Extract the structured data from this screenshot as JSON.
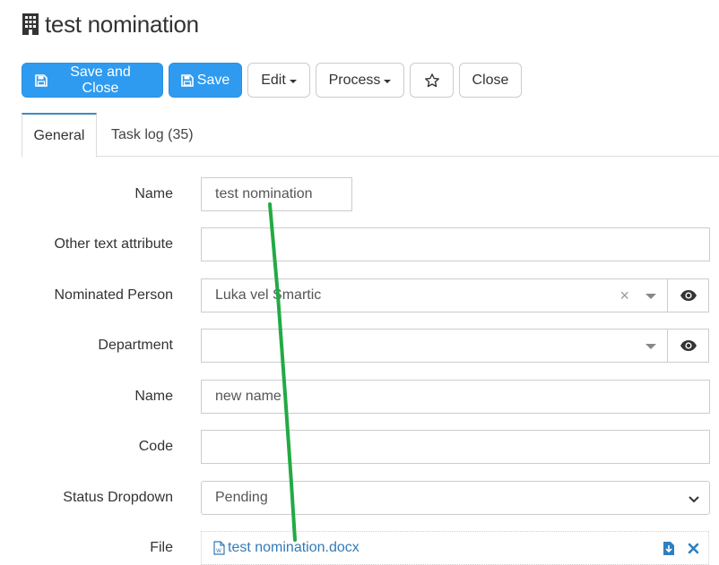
{
  "page": {
    "title": "test nomination",
    "icon": "building-icon"
  },
  "toolbar": {
    "save_close_label": "Save and Close",
    "save_label": "Save",
    "edit_label": "Edit",
    "process_label": "Process",
    "close_label": "Close",
    "primary_color": "#2f9bf0"
  },
  "tabs": [
    {
      "label": "General",
      "active": true
    },
    {
      "label": "Task log (35)",
      "active": false
    }
  ],
  "form": {
    "name": {
      "label": "Name",
      "value": "test nomination"
    },
    "other_text": {
      "label": "Other text attribute",
      "value": ""
    },
    "nominated_person": {
      "label": "Nominated Person",
      "value": "Luka vel Smartic"
    },
    "department": {
      "label": "Department",
      "value": ""
    },
    "name2": {
      "label": "Name",
      "value": "new name"
    },
    "code": {
      "label": "Code",
      "value": ""
    },
    "status": {
      "label": "Status Dropdown",
      "value": "Pending"
    },
    "file": {
      "label": "File",
      "value": "test nomination.docx"
    }
  },
  "annotation": {
    "color": "#22aa44"
  }
}
